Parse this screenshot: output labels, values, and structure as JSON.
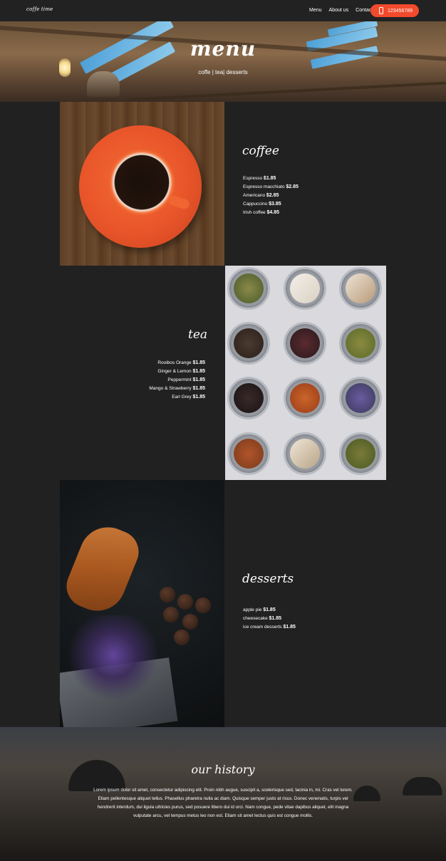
{
  "nav": {
    "logo": "coffe time",
    "links": [
      "Menu",
      "About us",
      "Contacts"
    ],
    "phone": "123456789",
    "phone_icon": "phone-icon"
  },
  "hero": {
    "title": "menu",
    "subtitle": "coffe | tea| desserts"
  },
  "coffee": {
    "title": "coffee",
    "items": [
      {
        "name": "Espresso",
        "price": "$1.85"
      },
      {
        "name": "Espresso macchiato",
        "price": "$2.85"
      },
      {
        "name": "Americano",
        "price": "$2.85"
      },
      {
        "name": "Cappuccino",
        "price": "$3.85"
      },
      {
        "name": "Irish coffee",
        "price": "$4.85"
      }
    ]
  },
  "tea": {
    "title": "tea",
    "items": [
      {
        "name": "Rooibos Orange",
        "price": "$1.85"
      },
      {
        "name": "Ginger & Lemon",
        "price": "$1.85"
      },
      {
        "name": "Peppermint",
        "price": "$1.85"
      },
      {
        "name": "Mango & Strawberry",
        "price": "$1.85"
      },
      {
        "name": "Earl Grey",
        "price": "$1.85"
      }
    ]
  },
  "desserts": {
    "title": "desserts",
    "items": [
      {
        "name": "apple pie",
        "price": "$1.85"
      },
      {
        "name": "cheesecake",
        "price": "$1.85"
      },
      {
        "name": "ice cream desserts",
        "price": "$1.85"
      }
    ]
  },
  "history": {
    "title": "our history",
    "text": "Lorem ipsum dolor sit amet, consectetur adipiscing elit. Proin nibh augue, suscipit a, scelerisque sed, lacinia in, mi. Cras vel lorem. Etiam pellentesque aliquet tellus. Phasellus pharetra nulla ac diam. Quisque semper justo at risus. Donec venenatis, turpis vel hendrerit interdum, dui ligula ultricies purus, sed posuere libero dui id orci. Nam congue, pede vitae dapibus aliquet, elit magna vulputate arcu, vel tempus metus leo non est. Etiam sit amet lectus quis est congue mollis."
  },
  "colors": {
    "background": "#212121",
    "accent": "#f24a2c"
  }
}
